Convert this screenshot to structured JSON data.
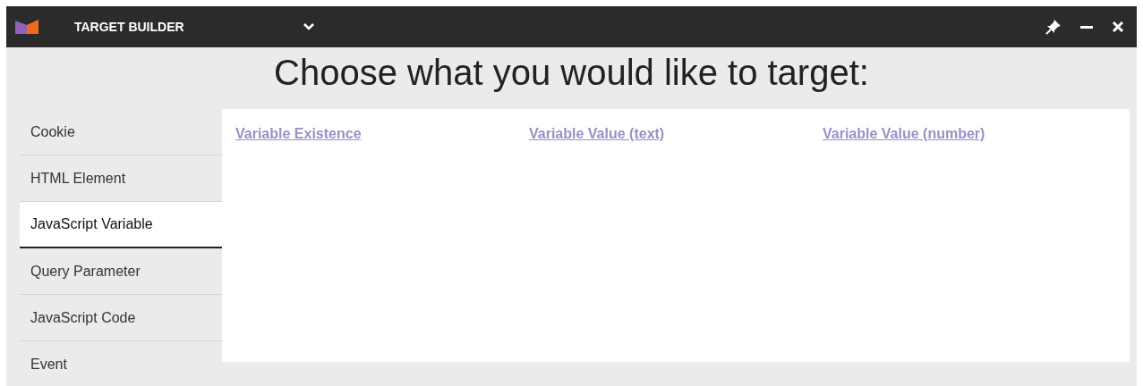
{
  "window": {
    "title": "TARGET BUILDER"
  },
  "heading": "Choose what you would like to target:",
  "sidebar": {
    "items": [
      {
        "label": "Cookie",
        "selected": false
      },
      {
        "label": "HTML Element",
        "selected": false
      },
      {
        "label": "JavaScript Variable",
        "selected": true
      },
      {
        "label": "Query Parameter",
        "selected": false
      },
      {
        "label": "JavaScript Code",
        "selected": false
      },
      {
        "label": "Event",
        "selected": false
      }
    ]
  },
  "options": [
    "Variable Existence",
    "Variable Value (text)",
    "Variable Value (number)"
  ]
}
